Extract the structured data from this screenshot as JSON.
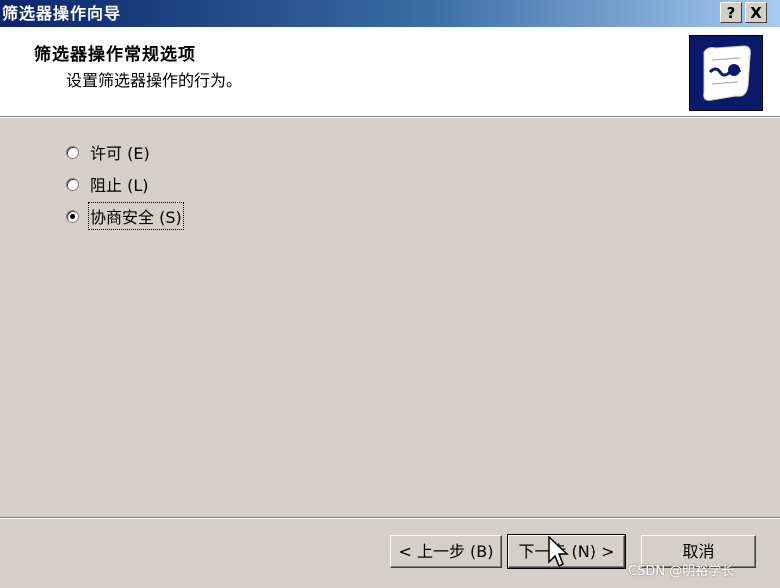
{
  "window": {
    "title": "筛选器操作向导",
    "help_button": "?",
    "close_button": "X"
  },
  "header": {
    "title": "筛选器操作常规选项",
    "subtitle": "设置筛选器操作的行为。",
    "icon": "certificate-scroll-icon"
  },
  "options": [
    {
      "label": "许可 (E)",
      "checked": false
    },
    {
      "label": "阻止 (L)",
      "checked": false
    },
    {
      "label": "协商安全 (S)",
      "checked": true
    }
  ],
  "buttons": {
    "back": "< 上一步 (B)",
    "next": "下一步 (N) >",
    "cancel": "取消"
  },
  "watermark": "CSDN @明裕学长",
  "colors": {
    "face": "#d4d0c8",
    "title_start": "#0a246a",
    "title_end": "#a6caf0"
  }
}
